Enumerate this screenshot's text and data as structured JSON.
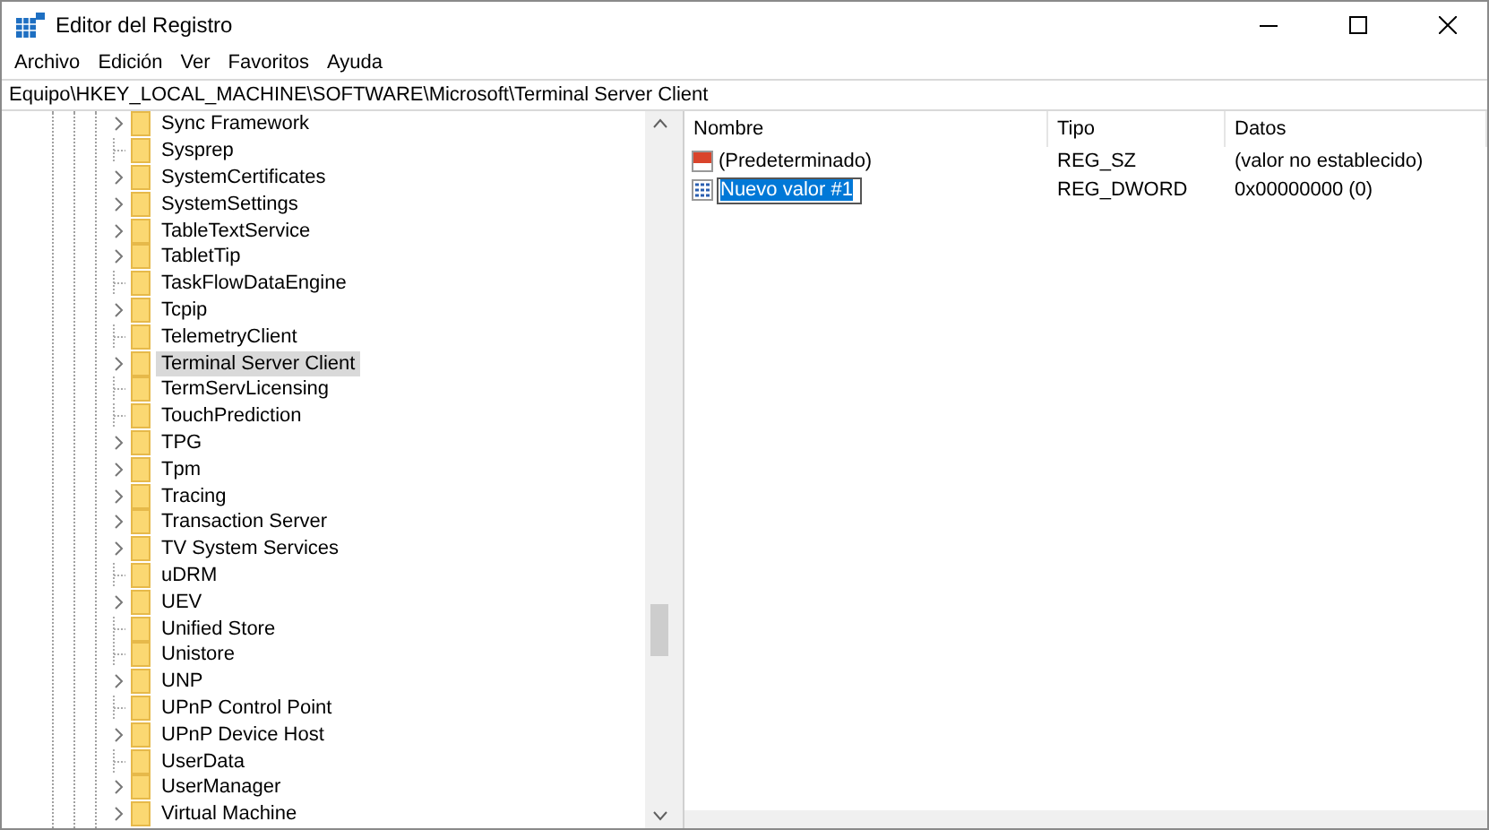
{
  "window": {
    "title": "Editor del Registro"
  },
  "menu": [
    "Archivo",
    "Edición",
    "Ver",
    "Favoritos",
    "Ayuda"
  ],
  "address": "Equipo\\HKEY_LOCAL_MACHINE\\SOFTWARE\\Microsoft\\Terminal Server Client",
  "tree": [
    {
      "label": "Sync Framework",
      "expandable": true,
      "selected": false
    },
    {
      "label": "Sysprep",
      "expandable": false,
      "selected": false
    },
    {
      "label": "SystemCertificates",
      "expandable": true,
      "selected": false
    },
    {
      "label": "SystemSettings",
      "expandable": true,
      "selected": false
    },
    {
      "label": "TableTextService",
      "expandable": true,
      "selected": false
    },
    {
      "label": "TabletTip",
      "expandable": true,
      "selected": false
    },
    {
      "label": "TaskFlowDataEngine",
      "expandable": false,
      "selected": false
    },
    {
      "label": "Tcpip",
      "expandable": true,
      "selected": false
    },
    {
      "label": "TelemetryClient",
      "expandable": false,
      "selected": false
    },
    {
      "label": "Terminal Server Client",
      "expandable": true,
      "selected": true
    },
    {
      "label": "TermServLicensing",
      "expandable": false,
      "selected": false
    },
    {
      "label": "TouchPrediction",
      "expandable": false,
      "selected": false
    },
    {
      "label": "TPG",
      "expandable": true,
      "selected": false
    },
    {
      "label": "Tpm",
      "expandable": true,
      "selected": false
    },
    {
      "label": "Tracing",
      "expandable": true,
      "selected": false
    },
    {
      "label": "Transaction Server",
      "expandable": true,
      "selected": false
    },
    {
      "label": "TV System Services",
      "expandable": true,
      "selected": false
    },
    {
      "label": "uDRM",
      "expandable": false,
      "selected": false
    },
    {
      "label": "UEV",
      "expandable": true,
      "selected": false
    },
    {
      "label": "Unified Store",
      "expandable": false,
      "selected": false
    },
    {
      "label": "Unistore",
      "expandable": false,
      "selected": false
    },
    {
      "label": "UNP",
      "expandable": true,
      "selected": false
    },
    {
      "label": "UPnP Control Point",
      "expandable": false,
      "selected": false
    },
    {
      "label": "UPnP Device Host",
      "expandable": true,
      "selected": false
    },
    {
      "label": "UserData",
      "expandable": false,
      "selected": false
    },
    {
      "label": "UserManager",
      "expandable": true,
      "selected": false
    },
    {
      "label": "Virtual Machine",
      "expandable": true,
      "selected": false
    }
  ],
  "values": {
    "columns": [
      "Nombre",
      "Tipo",
      "Datos"
    ],
    "rows": [
      {
        "kind": "string",
        "name": "(Predeterminado)",
        "type": "REG_SZ",
        "data": "(valor no establecido)",
        "editing": false
      },
      {
        "kind": "binary",
        "name": "Nuevo valor #1",
        "type": "REG_DWORD",
        "data": "0x00000000 (0)",
        "editing": true
      }
    ]
  }
}
